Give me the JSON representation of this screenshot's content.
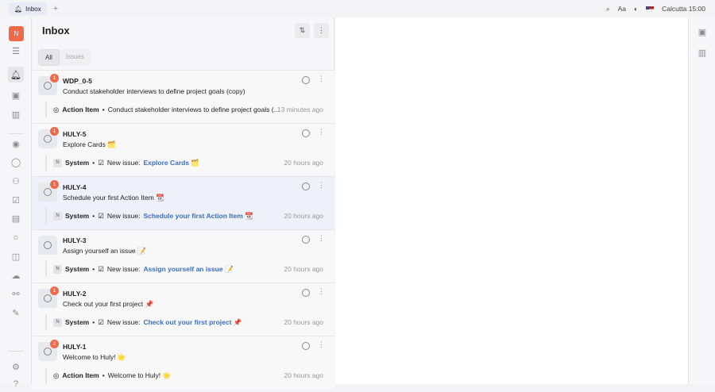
{
  "tabbar": {
    "tab_label": "Inbox",
    "new_tab": "+"
  },
  "topright": {
    "font_label": "Aa",
    "timezone": "Calcutta",
    "time": "15:00"
  },
  "workspace": {
    "avatar_letter": "N"
  },
  "inbox": {
    "title": "Inbox",
    "filters": [
      "All",
      "Issues"
    ],
    "items": [
      {
        "id": "WDP_0-5",
        "badge": "1",
        "title": "Conduct stakeholder interviews to define project goals (copy)",
        "author": "",
        "type": "Action Item",
        "message": "Conduct stakeholder interviews to define project goals (...",
        "link": "",
        "time": "13 minutes ago"
      },
      {
        "id": "HULY-5",
        "badge": "1",
        "title": "Explore Cards 🗂️",
        "author": "System",
        "type": "",
        "message": "New issue:",
        "link": "Explore Cards 🗂️",
        "time": "20 hours ago"
      },
      {
        "id": "HULY-4",
        "badge": "1",
        "title": "Schedule your first Action Item 📆",
        "author": "System",
        "type": "",
        "message": "New issue:",
        "link": "Schedule your first Action Item 📆",
        "time": "20 hours ago"
      },
      {
        "id": "HULY-3",
        "badge": "",
        "title": "Assign yourself an issue 📝",
        "author": "System",
        "type": "",
        "message": "New issue:",
        "link": "Assign yourself an issue 📝",
        "time": "20 hours ago"
      },
      {
        "id": "HULY-2",
        "badge": "1",
        "title": "Check out your first project 📌",
        "author": "System",
        "type": "",
        "message": "New issue:",
        "link": "Check out your first project 📌",
        "time": "20 hours ago"
      },
      {
        "id": "HULY-1",
        "badge": "2",
        "title": "Welcome to Huly! 🌟",
        "author": "",
        "type": "Action Item",
        "message": "Welcome to Huly! 🌟",
        "link": "",
        "time": "20 hours ago"
      }
    ]
  },
  "colors": {
    "accent": "#ef6a4b",
    "link": "#3b6fc4",
    "selected_row": "#eef1f9"
  }
}
